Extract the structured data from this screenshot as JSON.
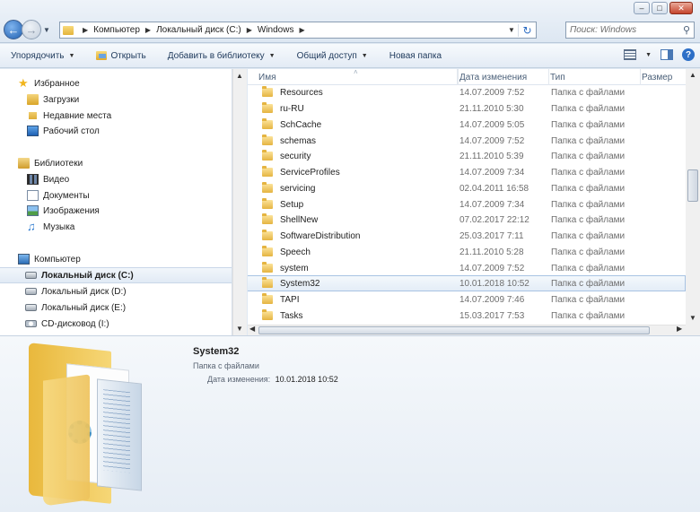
{
  "window": {
    "minimize": "–",
    "maximize": "□",
    "close": "✕"
  },
  "address": {
    "crumbs": [
      "Компьютер",
      "Локальный диск (C:)",
      "Windows"
    ]
  },
  "search": {
    "placeholder": "Поиск: Windows"
  },
  "toolbar": {
    "organize": "Упорядочить",
    "open": "Открыть",
    "add_to_library": "Добавить в библиотеку",
    "share": "Общий доступ",
    "new_folder": "Новая папка"
  },
  "nav": {
    "favorites": "Избранное",
    "downloads": "Загрузки",
    "recent": "Недавние места",
    "desktop": "Рабочий стол",
    "libraries": "Библиотеки",
    "video": "Видео",
    "documents": "Документы",
    "pictures": "Изображения",
    "music": "Музыка",
    "computer": "Компьютер",
    "drive_c": "Локальный диск (C:)",
    "drive_d": "Локальный диск (D:)",
    "drive_e": "Локальный диск (E:)",
    "cd": "CD-дисковод (I:)"
  },
  "columns": {
    "name": "Имя",
    "date": "Дата изменения",
    "type": "Тип",
    "size": "Размер"
  },
  "files": [
    {
      "name": "Resources",
      "date": "14.07.2009 7:52",
      "type": "Папка с файлами"
    },
    {
      "name": "ru-RU",
      "date": "21.11.2010 5:30",
      "type": "Папка с файлами"
    },
    {
      "name": "SchCache",
      "date": "14.07.2009 5:05",
      "type": "Папка с файлами"
    },
    {
      "name": "schemas",
      "date": "14.07.2009 7:52",
      "type": "Папка с файлами"
    },
    {
      "name": "security",
      "date": "21.11.2010 5:39",
      "type": "Папка с файлами"
    },
    {
      "name": "ServiceProfiles",
      "date": "14.07.2009 7:34",
      "type": "Папка с файлами"
    },
    {
      "name": "servicing",
      "date": "02.04.2011 16:58",
      "type": "Папка с файлами"
    },
    {
      "name": "Setup",
      "date": "14.07.2009 7:34",
      "type": "Папка с файлами"
    },
    {
      "name": "ShellNew",
      "date": "07.02.2017 22:12",
      "type": "Папка с файлами"
    },
    {
      "name": "SoftwareDistribution",
      "date": "25.03.2017 7:11",
      "type": "Папка с файлами"
    },
    {
      "name": "Speech",
      "date": "21.11.2010 5:28",
      "type": "Папка с файлами"
    },
    {
      "name": "system",
      "date": "14.07.2009 7:52",
      "type": "Папка с файлами"
    },
    {
      "name": "System32",
      "date": "10.01.2018 10:52",
      "type": "Папка с файлами"
    },
    {
      "name": "TAPI",
      "date": "14.07.2009 7:46",
      "type": "Папка с файлами"
    },
    {
      "name": "Tasks",
      "date": "15.03.2017 7:53",
      "type": "Папка с файлами"
    }
  ],
  "details": {
    "title": "System32",
    "type": "Папка с файлами",
    "modified_label": "Дата изменения:",
    "modified_value": "10.01.2018 10:52"
  }
}
